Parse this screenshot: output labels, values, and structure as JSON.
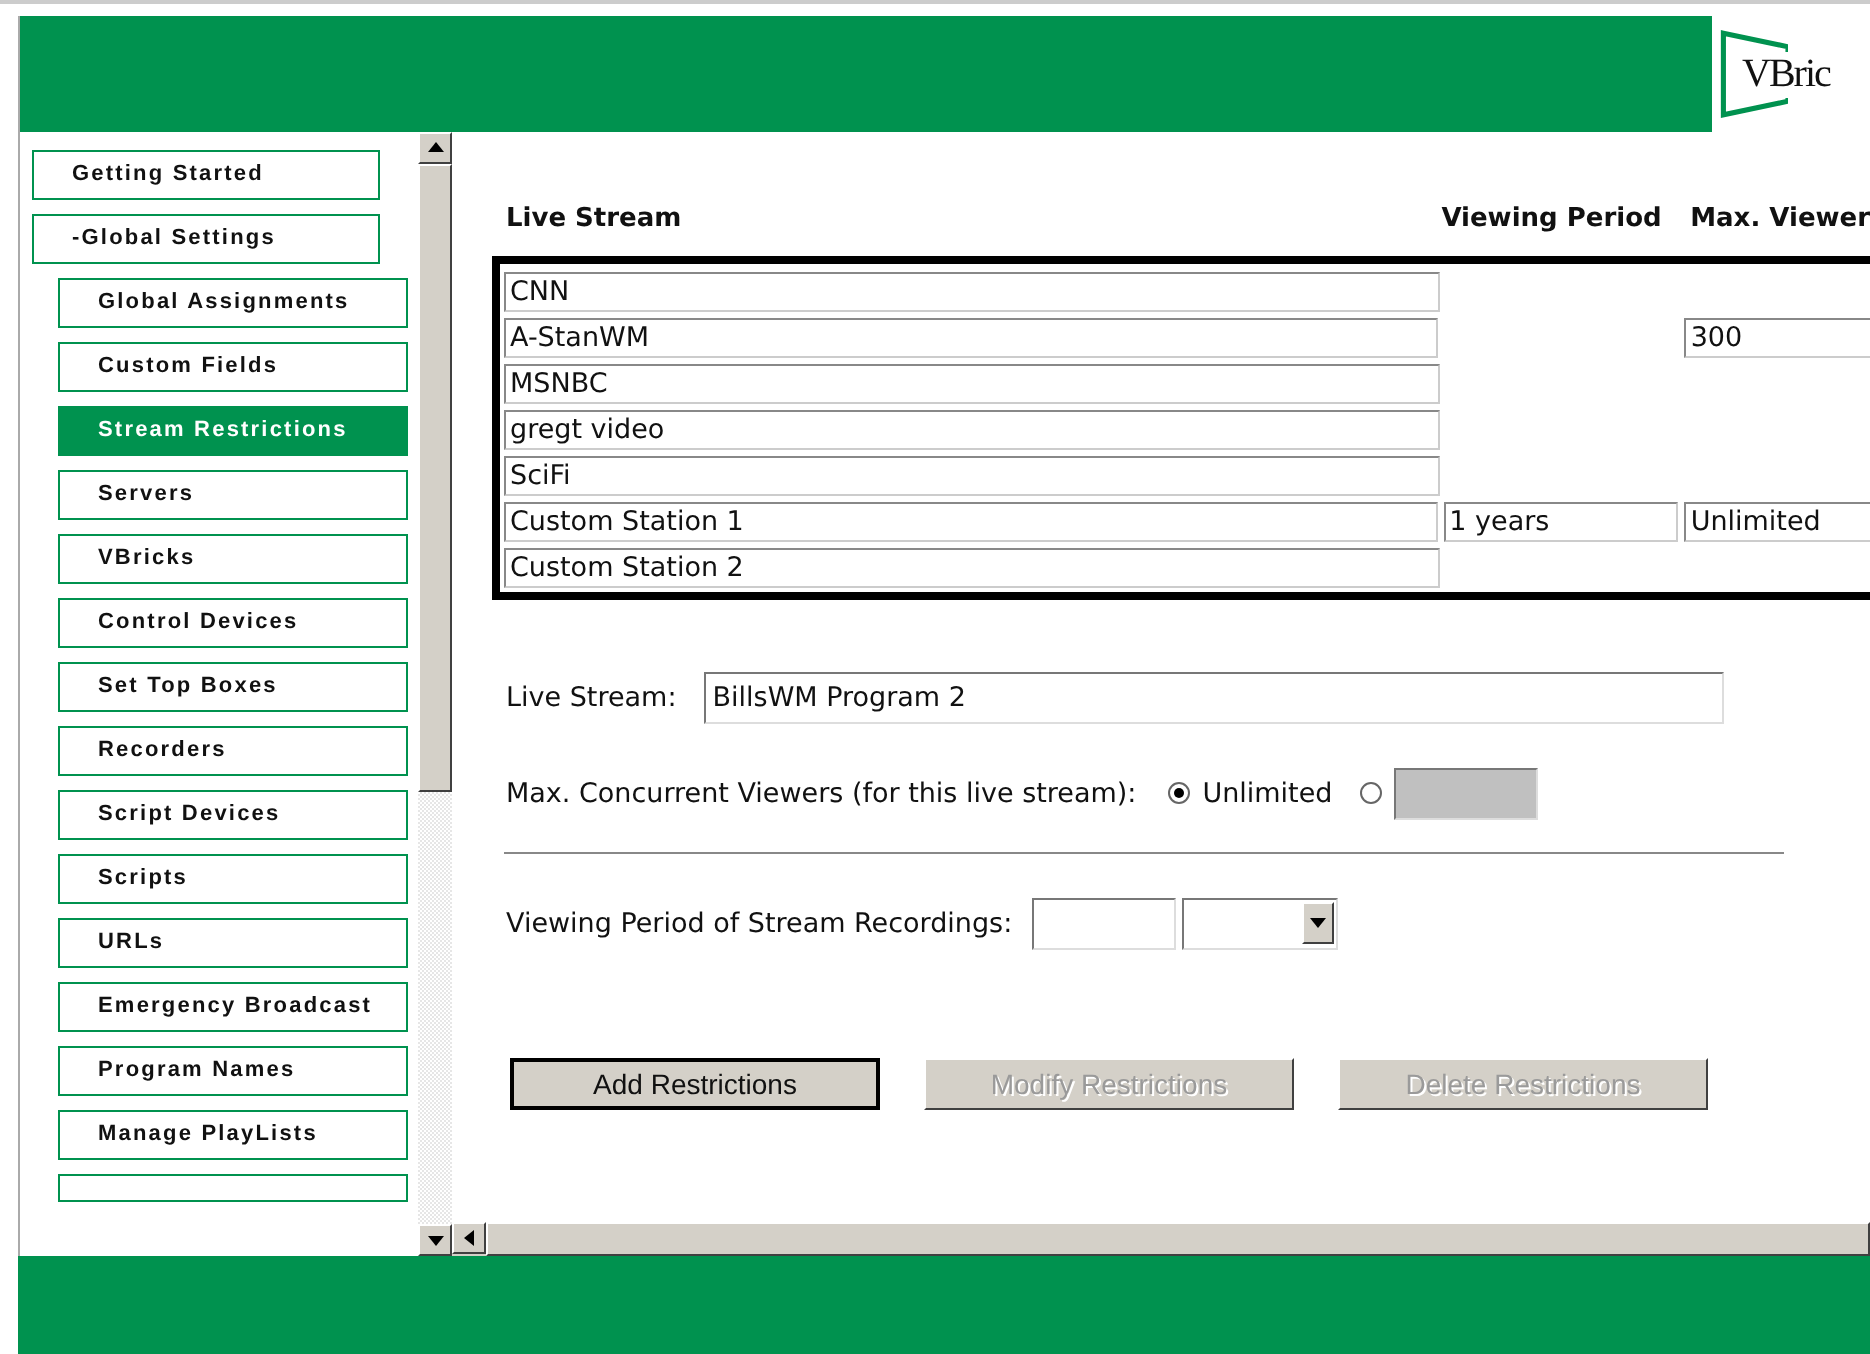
{
  "logo": {
    "text": "VBric"
  },
  "sidebar": {
    "items": [
      {
        "label": "Getting Started",
        "selected": false
      },
      {
        "label": "-Global Settings",
        "selected": false,
        "children": [
          {
            "label": "Global Assignments",
            "selected": false
          },
          {
            "label": "Custom Fields",
            "selected": false
          },
          {
            "label": "Stream Restrictions",
            "selected": true
          },
          {
            "label": "Servers",
            "selected": false
          },
          {
            "label": "VBricks",
            "selected": false
          },
          {
            "label": "Control Devices",
            "selected": false
          },
          {
            "label": "Set Top Boxes",
            "selected": false
          },
          {
            "label": "Recorders",
            "selected": false
          },
          {
            "label": "Script Devices",
            "selected": false
          },
          {
            "label": "Scripts",
            "selected": false
          },
          {
            "label": "URLs",
            "selected": false
          },
          {
            "label": "Emergency Broadcast",
            "selected": false
          },
          {
            "label": "Program Names",
            "selected": false
          },
          {
            "label": "Manage PlayLists",
            "selected": false
          }
        ]
      }
    ]
  },
  "table": {
    "columns": [
      "Live Stream",
      "Viewing Period",
      "Max. Viewer"
    ],
    "rows": [
      {
        "live_stream": "CNN"
      },
      {
        "live_stream": "A-StanWM",
        "max_viewers": "300"
      },
      {
        "live_stream": "MSNBC"
      },
      {
        "live_stream": "gregt video"
      },
      {
        "live_stream": "SciFi"
      },
      {
        "live_stream": "Custom Station 1",
        "viewing_period": "1 years",
        "max_viewers": "Unlimited"
      },
      {
        "live_stream": "Custom Station 2"
      }
    ]
  },
  "form": {
    "live_stream": {
      "label": "Live Stream:",
      "value": "BillsWM Program 2"
    },
    "max_viewers": {
      "label": "Max. Concurrent Viewers (for this live stream):",
      "options": [
        {
          "label": "Unlimited",
          "selected": true
        },
        {
          "selected": false
        }
      ]
    },
    "viewing_period": {
      "label": "Viewing Period of Stream Recordings:"
    }
  },
  "buttons": [
    {
      "label": "Add Restrictions",
      "disabled": false
    },
    {
      "label": "Modify Restrictions",
      "disabled": true
    },
    {
      "label": "Delete Restrictions",
      "disabled": true
    }
  ]
}
